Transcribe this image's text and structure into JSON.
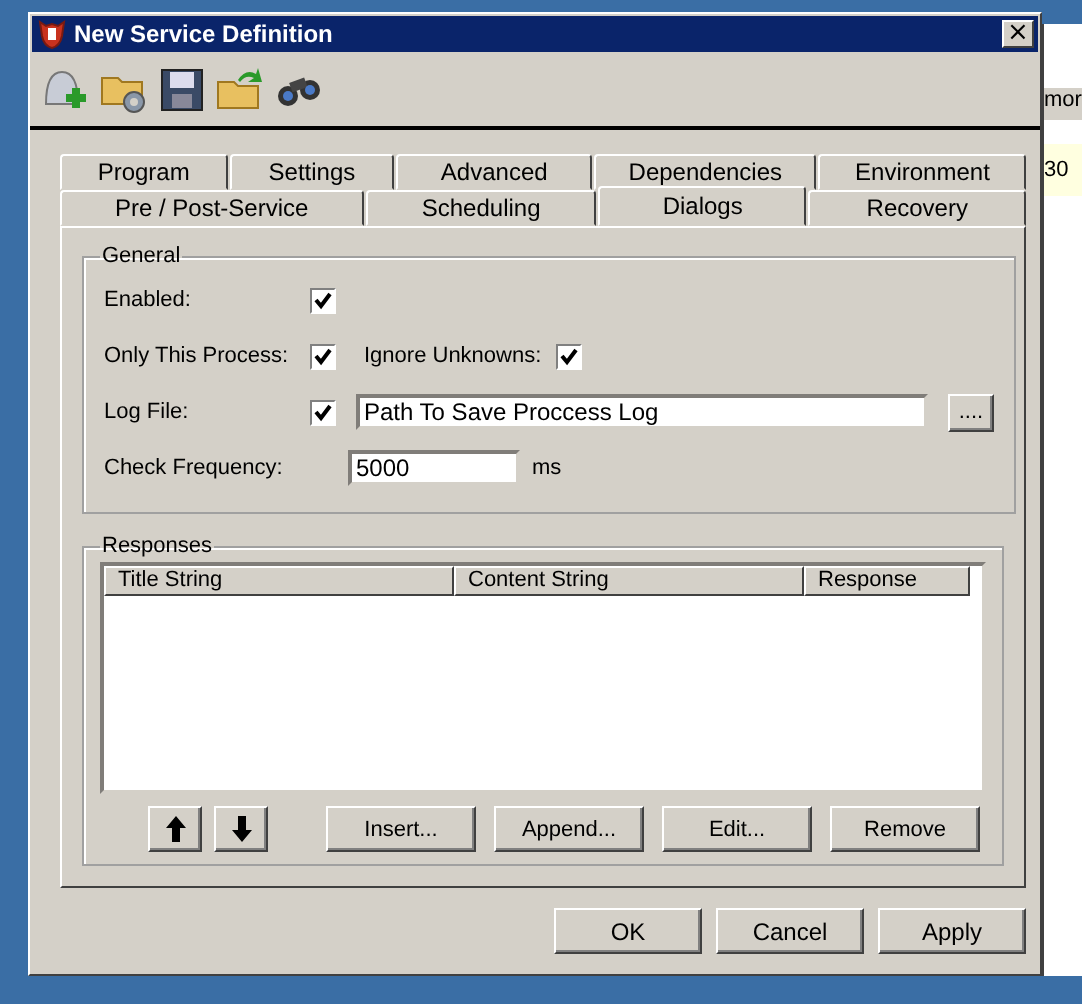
{
  "window": {
    "title": "New Service Definition",
    "close": "×"
  },
  "background_window": {
    "header": "mor",
    "cell": "30"
  },
  "tabs": [
    [
      {
        "label": "Program",
        "selected": false
      },
      {
        "label": "Settings",
        "selected": false
      },
      {
        "label": "Advanced",
        "selected": false
      },
      {
        "label": "Dependencies",
        "selected": false
      },
      {
        "label": "Environment",
        "selected": false
      }
    ],
    [
      {
        "label": "Pre / Post-Service",
        "selected": false
      },
      {
        "label": "Scheduling",
        "selected": false
      },
      {
        "label": "Dialogs",
        "selected": true
      },
      {
        "label": "Recovery",
        "selected": false
      }
    ]
  ],
  "general": {
    "title": "General",
    "enabled": {
      "label": "Enabled:",
      "checked": true
    },
    "only_this_process": {
      "label": "Only This Process:",
      "checked": true
    },
    "ignore_unknowns": {
      "label": "Ignore Unknowns:",
      "checked": true
    },
    "log_file": {
      "label": "Log File:",
      "checked": true,
      "value": "Path To Save Proccess Log",
      "browse": "...."
    },
    "check_frequency": {
      "label": "Check Frequency:",
      "value": "5000",
      "unit": "ms"
    }
  },
  "responses": {
    "title": "Responses",
    "columns": [
      "Title String",
      "Content String",
      "Response"
    ],
    "buttons": [
      "Insert...",
      "Append...",
      "Edit...",
      "Remove"
    ]
  },
  "buttons": [
    "OK",
    "Cancel",
    "Apply"
  ]
}
